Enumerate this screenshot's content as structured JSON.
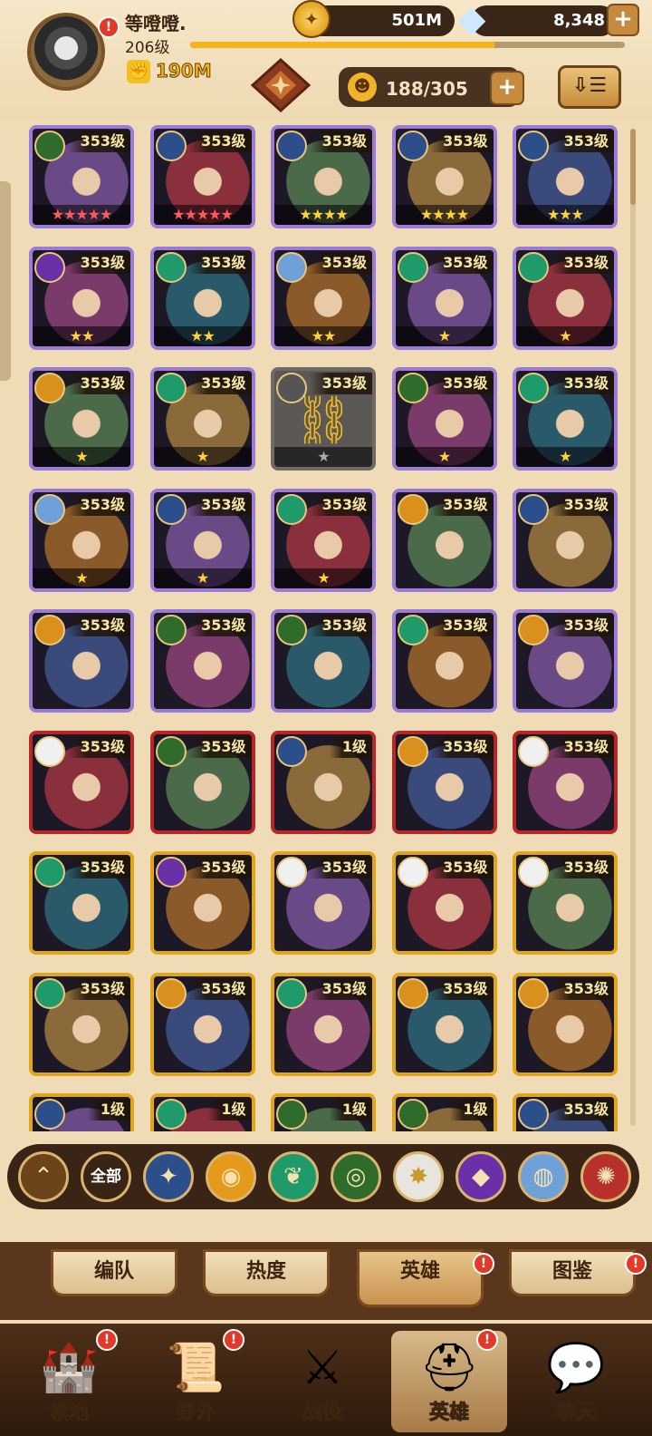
{
  "player": {
    "name": "等噔噔.",
    "level": "206级",
    "power": "190M",
    "xp_fraction": 0.7
  },
  "currency": {
    "gold": "501M",
    "gems": "8,348"
  },
  "roster": {
    "capacity": "188/305"
  },
  "filter": {
    "all_label": "全部"
  },
  "heroes": [
    {
      "level": "353级",
      "frame": "purple",
      "faction": "forsaken",
      "stars": 5,
      "star_color": "red"
    },
    {
      "level": "353级",
      "frame": "purple",
      "faction": "lightbearer",
      "stars": 5,
      "star_color": "red"
    },
    {
      "level": "353级",
      "frame": "purple",
      "faction": "lightbearer",
      "stars": 4,
      "star_color": "yellow"
    },
    {
      "level": "353级",
      "frame": "purple",
      "faction": "lightbearer",
      "stars": 4,
      "star_color": "yellow"
    },
    {
      "level": "353级",
      "frame": "purple",
      "faction": "lightbearer",
      "stars": 3,
      "star_color": "yellow"
    },
    {
      "level": "353级",
      "frame": "purple",
      "faction": "graveborn",
      "stars": 2,
      "star_color": "yellow"
    },
    {
      "level": "353级",
      "frame": "purple",
      "faction": "wilder",
      "stars": 2,
      "star_color": "yellow"
    },
    {
      "level": "353级",
      "frame": "purple",
      "faction": "celestial",
      "stars": 2,
      "star_color": "yellow"
    },
    {
      "level": "353级",
      "frame": "purple",
      "faction": "wilder",
      "stars": 1,
      "star_color": "yellow"
    },
    {
      "level": "353级",
      "frame": "purple",
      "faction": "wilder",
      "stars": 1,
      "star_color": "yellow"
    },
    {
      "level": "353级",
      "frame": "purple",
      "faction": "mauler",
      "stars": 1,
      "star_color": "yellow"
    },
    {
      "level": "353级",
      "frame": "purple",
      "faction": "wilder",
      "stars": 1,
      "star_color": "yellow"
    },
    {
      "level": "353级",
      "frame": "grey",
      "faction": "locked",
      "stars": 1,
      "star_color": "grey",
      "linked": true
    },
    {
      "level": "353级",
      "frame": "purple",
      "faction": "forsaken",
      "stars": 1,
      "star_color": "yellow"
    },
    {
      "level": "353级",
      "frame": "purple",
      "faction": "wilder",
      "stars": 1,
      "star_color": "yellow"
    },
    {
      "level": "353级",
      "frame": "purple",
      "faction": "celestial",
      "stars": 1,
      "star_color": "yellow"
    },
    {
      "level": "353级",
      "frame": "purple",
      "faction": "lightbearer",
      "stars": 1,
      "star_color": "yellow"
    },
    {
      "level": "353级",
      "frame": "purple",
      "faction": "wilder",
      "stars": 1,
      "star_color": "yellow"
    },
    {
      "level": "353级",
      "frame": "purple",
      "faction": "mauler",
      "stars": 0,
      "star_color": "yellow"
    },
    {
      "level": "353级",
      "frame": "purple",
      "faction": "lightbearer",
      "stars": 0,
      "star_color": "yellow"
    },
    {
      "level": "353级",
      "frame": "purple",
      "faction": "mauler",
      "stars": 0,
      "star_color": "yellow"
    },
    {
      "level": "353级",
      "frame": "purple",
      "faction": "forsaken",
      "stars": 0,
      "star_color": "yellow"
    },
    {
      "level": "353级",
      "frame": "purple",
      "faction": "forsaken",
      "stars": 0,
      "star_color": "yellow"
    },
    {
      "level": "353级",
      "frame": "purple",
      "faction": "wilder",
      "stars": 0,
      "star_color": "yellow"
    },
    {
      "level": "353级",
      "frame": "purple",
      "faction": "mauler",
      "stars": 0,
      "star_color": "yellow"
    },
    {
      "level": "353级",
      "frame": "red",
      "faction": "hypogean",
      "stars": 0,
      "star_color": "yellow"
    },
    {
      "level": "353级",
      "frame": "red",
      "faction": "forsaken",
      "stars": 0,
      "star_color": "yellow"
    },
    {
      "level": "1级",
      "frame": "red",
      "faction": "lightbearer",
      "stars": 0,
      "star_color": "yellow"
    },
    {
      "level": "353级",
      "frame": "red",
      "faction": "mauler",
      "stars": 0,
      "star_color": "yellow"
    },
    {
      "level": "353级",
      "frame": "red",
      "faction": "hypogean",
      "stars": 0,
      "star_color": "yellow"
    },
    {
      "level": "353级",
      "frame": "gold",
      "faction": "wilder",
      "stars": 0,
      "star_color": "yellow"
    },
    {
      "level": "353级",
      "frame": "gold",
      "faction": "graveborn",
      "stars": 0,
      "star_color": "yellow"
    },
    {
      "level": "353级",
      "frame": "gold",
      "faction": "hypogean",
      "stars": 0,
      "star_color": "yellow"
    },
    {
      "level": "353级",
      "frame": "gold",
      "faction": "hypogean",
      "stars": 0,
      "star_color": "yellow"
    },
    {
      "level": "353级",
      "frame": "gold",
      "faction": "hypogean",
      "stars": 0,
      "star_color": "yellow"
    },
    {
      "level": "353级",
      "frame": "gold",
      "faction": "wilder",
      "stars": 0,
      "star_color": "yellow"
    },
    {
      "level": "353级",
      "frame": "gold",
      "faction": "mauler",
      "stars": 0,
      "star_color": "yellow"
    },
    {
      "level": "353级",
      "frame": "gold",
      "faction": "wilder",
      "stars": 0,
      "star_color": "yellow"
    },
    {
      "level": "353级",
      "frame": "gold",
      "faction": "mauler",
      "stars": 0,
      "star_color": "yellow"
    },
    {
      "level": "353级",
      "frame": "gold",
      "faction": "mauler",
      "stars": 0,
      "star_color": "yellow"
    },
    {
      "level": "1级",
      "frame": "gold",
      "faction": "lightbearer",
      "stars": 0,
      "star_color": "yellow"
    },
    {
      "level": "1级",
      "frame": "gold",
      "faction": "wilder",
      "stars": 0,
      "star_color": "yellow"
    },
    {
      "level": "1级",
      "frame": "gold",
      "faction": "forsaken",
      "stars": 0,
      "star_color": "yellow"
    },
    {
      "level": "1级",
      "frame": "gold",
      "faction": "forsaken",
      "stars": 0,
      "star_color": "yellow"
    },
    {
      "level": "353级",
      "frame": "gold",
      "faction": "lightbearer",
      "stars": 0,
      "star_color": "yellow"
    }
  ],
  "faction_colors": {
    "lightbearer": "#2c4f8c",
    "mauler": "#d9901c",
    "wilder": "#1f9a6a",
    "forsaken": "#2f6b2a",
    "graveborn": "#6b2fa8",
    "celestial": "#6fa0d8",
    "hypogean": "#f0f0f0",
    "dimensional": "#c2382a",
    "locked": "#555"
  },
  "filter_buttons": [
    {
      "name": "filter-promote-button",
      "glyph": "⌃",
      "color": "#6b4519"
    },
    {
      "name": "filter-all-button",
      "label_key": "filter.all_label",
      "color": "#3a2415"
    },
    {
      "name": "filter-lightbearer-button",
      "glyph": "✦",
      "color": "#2c4f8c"
    },
    {
      "name": "filter-mauler-button",
      "glyph": "◉",
      "color": "#e59a1b"
    },
    {
      "name": "filter-wilder-button",
      "glyph": "❦",
      "color": "#1f9a6a"
    },
    {
      "name": "filter-graveborn-button",
      "glyph": "◎",
      "color": "#2f6b2a"
    },
    {
      "name": "filter-celestial-button",
      "glyph": "✸",
      "color": "#e8e4de"
    },
    {
      "name": "filter-hypogean-button",
      "glyph": "◆",
      "color": "#6b2fa8"
    },
    {
      "name": "filter-dimensional-button",
      "glyph": "◍",
      "color": "#6fa0d8"
    },
    {
      "name": "filter-fire-button",
      "glyph": "✺",
      "color": "#b8302a"
    }
  ],
  "sub_tabs": [
    {
      "label": "编队",
      "active": false,
      "badge": false
    },
    {
      "label": "热度",
      "active": false,
      "badge": false
    },
    {
      "label": "英雄",
      "active": true,
      "badge": true
    },
    {
      "label": "图鉴",
      "active": false,
      "badge": true
    }
  ],
  "bottom_nav": [
    {
      "label": "领地",
      "icon": "castle-icon",
      "glyph": "🏰",
      "active": false,
      "badge": true
    },
    {
      "label": "野外",
      "icon": "map-scroll-icon",
      "glyph": "📜",
      "active": false,
      "badge": true
    },
    {
      "label": "战役",
      "icon": "sword-icon",
      "glyph": "⚔",
      "active": false,
      "badge": false
    },
    {
      "label": "英雄",
      "icon": "helmet-icon",
      "glyph": "⛑",
      "active": true,
      "badge": true
    },
    {
      "label": "聊天",
      "icon": "chat-icon",
      "glyph": "💬",
      "active": false,
      "badge": false
    }
  ],
  "badge_mark": "!"
}
